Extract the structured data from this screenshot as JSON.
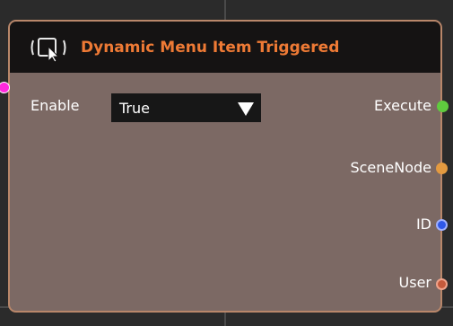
{
  "node": {
    "title": "Dynamic Menu Item Triggered",
    "icon": "menu-item-cursor-icon",
    "inputs": [
      {
        "label": "Enable",
        "value": "True",
        "pin_color": "#ff28dc"
      }
    ],
    "outputs": [
      {
        "label": "Execute",
        "pin_color": "#5fcb3e"
      },
      {
        "label": "SceneNode",
        "pin_color": "#e39a40"
      },
      {
        "label": "ID",
        "pin_color": "#2f58e8"
      },
      {
        "label": "User",
        "pin_color": "#c45a3c"
      }
    ]
  },
  "colors": {
    "canvas": "#2b2b2b",
    "node_body": "#7c6964",
    "node_border": "#b9876a",
    "header": "#151313",
    "title": "#ee7a35"
  }
}
